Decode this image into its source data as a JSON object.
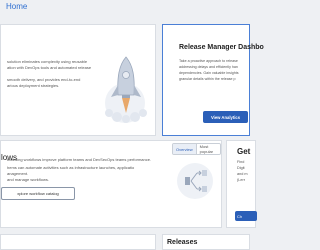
{
  "breadcrumb": "Home",
  "hero": {
    "lines": [
      "solution eliminates complexity using reusable",
      "ation with DevOps tools and automated release",
      "",
      "smooth delivery, and provides end-to-end",
      "arious deployment strategies."
    ]
  },
  "release_manager": {
    "title": "Release Manager Dashbo",
    "lines": [
      "Take a proactive approach to release",
      "addressing delays and efficiently han",
      "dependencies. Gain valuable insights",
      "granular details within the release p"
    ],
    "button_label": "View Analytics"
  },
  "workflows": {
    "title": "lows",
    "tabs": [
      "Overview",
      "Most popular"
    ],
    "lines": [
      "boarding workflows improve platform teams and DevSecOps teams performance.",
      "hems can automate activities such as infrastructure launches, applicatio",
      "anagement.",
      "",
      "and manage workflows."
    ],
    "button_label": "xplore workflow catalog"
  },
  "get_started": {
    "title": "Get",
    "lines": [
      "Find",
      "Digit",
      "and m",
      "(Lerr"
    ],
    "button_label": "Ch"
  },
  "releases": {
    "title": "Releases"
  },
  "colors": {
    "accent": "#2b5fb8",
    "rocket": "#b9c3d3",
    "flame": "#e8a86a"
  }
}
